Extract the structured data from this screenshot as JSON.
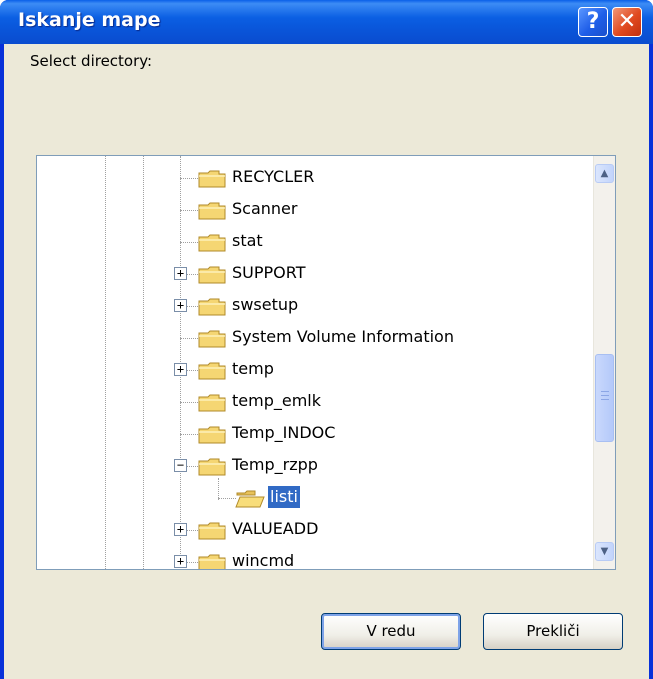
{
  "window": {
    "title": "Iskanje mape",
    "help_symbol": "?",
    "close_symbol": "✕"
  },
  "prompt": "Select directory:",
  "tree": {
    "items": [
      {
        "label": "RECYCLER",
        "expander": "",
        "selected": false
      },
      {
        "label": "Scanner",
        "expander": "",
        "selected": false
      },
      {
        "label": "stat",
        "expander": "",
        "selected": false
      },
      {
        "label": "SUPPORT",
        "expander": "+",
        "selected": false
      },
      {
        "label": "swsetup",
        "expander": "+",
        "selected": false
      },
      {
        "label": "System Volume Information",
        "expander": "",
        "selected": false
      },
      {
        "label": "temp",
        "expander": "+",
        "selected": false
      },
      {
        "label": "temp_emlk",
        "expander": "",
        "selected": false
      },
      {
        "label": "Temp_INDOC",
        "expander": "",
        "selected": false
      },
      {
        "label": "Temp_rzpp",
        "expander": "−",
        "selected": false
      },
      {
        "label": "listi",
        "expander": "",
        "selected": true
      },
      {
        "label": "VALUEADD",
        "expander": "+",
        "selected": false
      },
      {
        "label": "wincmd",
        "expander": "+",
        "selected": false
      }
    ]
  },
  "scrollbar": {
    "up_arrow": "▲",
    "down_arrow": "▼"
  },
  "buttons": {
    "ok": "V redu",
    "cancel": "Prekliči"
  },
  "colors": {
    "title_bar": "#0a54d8",
    "selection": "#316ac5",
    "dialog_bg": "#ece9d8",
    "close_button": "#e0491f"
  }
}
